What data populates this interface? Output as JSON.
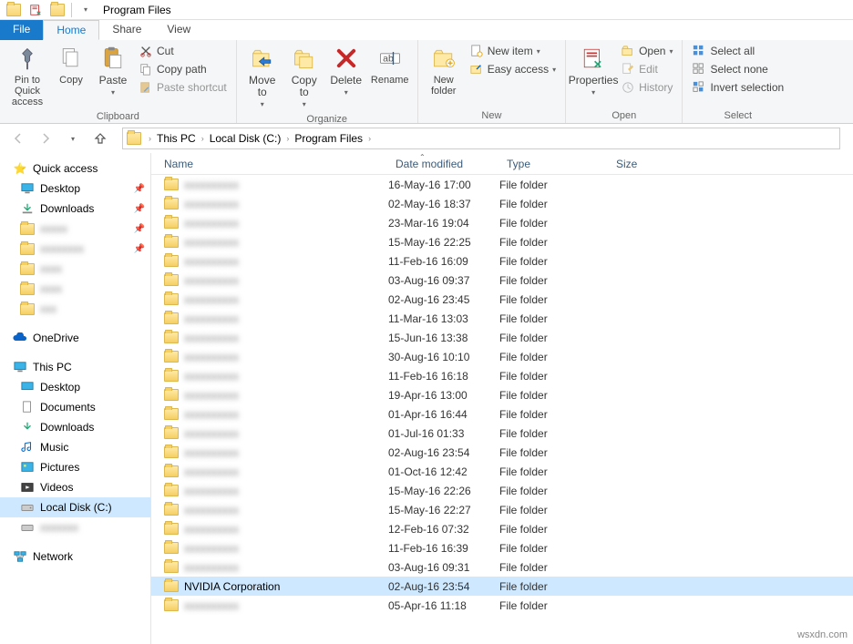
{
  "window": {
    "title": "Program Files"
  },
  "tabs": {
    "file": "File",
    "home": "Home",
    "share": "Share",
    "view": "View"
  },
  "ribbon": {
    "clipboard": {
      "label": "Clipboard",
      "pin": "Pin to Quick access",
      "copy": "Copy",
      "paste": "Paste",
      "cut": "Cut",
      "copy_path": "Copy path",
      "paste_shortcut": "Paste shortcut"
    },
    "organize": {
      "label": "Organize",
      "move_to": "Move to",
      "copy_to": "Copy to",
      "delete": "Delete",
      "rename": "Rename"
    },
    "new": {
      "label": "New",
      "new_folder": "New folder",
      "new_item": "New item",
      "easy_access": "Easy access"
    },
    "open": {
      "label": "Open",
      "properties": "Properties",
      "open": "Open",
      "edit": "Edit",
      "history": "History"
    },
    "select": {
      "label": "Select",
      "select_all": "Select all",
      "select_none": "Select none",
      "invert": "Invert selection"
    }
  },
  "breadcrumb": [
    "This PC",
    "Local Disk (C:)",
    "Program Files"
  ],
  "columns": {
    "name": "Name",
    "date": "Date modified",
    "type": "Type",
    "size": "Size"
  },
  "sidebar": {
    "quick_access": "Quick access",
    "desktop": "Desktop",
    "downloads": "Downloads",
    "onedrive": "OneDrive",
    "this_pc": "This PC",
    "desktop2": "Desktop",
    "documents": "Documents",
    "downloads2": "Downloads",
    "music": "Music",
    "pictures": "Pictures",
    "videos": "Videos",
    "local_disk": "Local Disk (C:)",
    "network": "Network"
  },
  "rows": [
    {
      "name": "",
      "blur": true,
      "date": "16-May-16 17:00",
      "type": "File folder"
    },
    {
      "name": "",
      "blur": true,
      "date": "02-May-16 18:37",
      "type": "File folder"
    },
    {
      "name": "",
      "blur": true,
      "date": "23-Mar-16 19:04",
      "type": "File folder"
    },
    {
      "name": "",
      "blur": true,
      "date": "15-May-16 22:25",
      "type": "File folder"
    },
    {
      "name": "",
      "blur": true,
      "date": "11-Feb-16 16:09",
      "type": "File folder"
    },
    {
      "name": "",
      "blur": true,
      "date": "03-Aug-16 09:37",
      "type": "File folder"
    },
    {
      "name": "",
      "blur": true,
      "date": "02-Aug-16 23:45",
      "type": "File folder"
    },
    {
      "name": "",
      "blur": true,
      "date": "11-Mar-16 13:03",
      "type": "File folder"
    },
    {
      "name": "",
      "blur": true,
      "date": "15-Jun-16 13:38",
      "type": "File folder"
    },
    {
      "name": "",
      "blur": true,
      "date": "30-Aug-16 10:10",
      "type": "File folder"
    },
    {
      "name": "",
      "blur": true,
      "date": "11-Feb-16 16:18",
      "type": "File folder"
    },
    {
      "name": "",
      "blur": true,
      "date": "19-Apr-16 13:00",
      "type": "File folder"
    },
    {
      "name": "",
      "blur": true,
      "date": "01-Apr-16 16:44",
      "type": "File folder"
    },
    {
      "name": "",
      "blur": true,
      "date": "01-Jul-16 01:33",
      "type": "File folder"
    },
    {
      "name": "",
      "blur": true,
      "date": "02-Aug-16 23:54",
      "type": "File folder"
    },
    {
      "name": "",
      "blur": true,
      "date": "01-Oct-16 12:42",
      "type": "File folder"
    },
    {
      "name": "",
      "blur": true,
      "date": "15-May-16 22:26",
      "type": "File folder"
    },
    {
      "name": "",
      "blur": true,
      "date": "15-May-16 22:27",
      "type": "File folder"
    },
    {
      "name": "",
      "blur": true,
      "date": "12-Feb-16 07:32",
      "type": "File folder"
    },
    {
      "name": "",
      "blur": true,
      "date": "11-Feb-16 16:39",
      "type": "File folder"
    },
    {
      "name": "",
      "blur": true,
      "date": "03-Aug-16 09:31",
      "type": "File folder"
    },
    {
      "name": "NVIDIA Corporation",
      "blur": false,
      "date": "02-Aug-16 23:54",
      "type": "File folder",
      "selected": true
    },
    {
      "name": "",
      "blur": true,
      "date": "05-Apr-16 11:18",
      "type": "File folder"
    }
  ],
  "watermark": "wsxdn.com"
}
